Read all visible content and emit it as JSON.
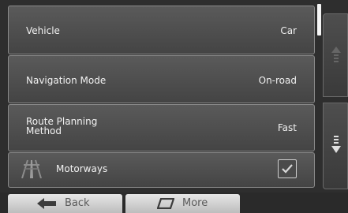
{
  "settings": {
    "vehicle": {
      "label": "Vehicle",
      "value": "Car"
    },
    "navigation_mode": {
      "label": "Navigation Mode",
      "value": "On-road"
    },
    "route_planning": {
      "label_line1": "Route Planning",
      "label_line2": "Method",
      "value": "Fast"
    },
    "motorways": {
      "label": "Motorways",
      "checked": true,
      "icon": "motorway-icon"
    }
  },
  "scroll": {
    "up_icon": "scroll-up-arrow-icon",
    "down_icon": "scroll-down-arrow-icon"
  },
  "bottom_bar": {
    "back_label": "Back",
    "more_label": "More",
    "back_icon": "back-arrow-icon",
    "more_icon": "more-icon"
  },
  "colors": {
    "background": "#2e2e2e",
    "row": "#4f4f4f",
    "button": "#d5d5d5"
  }
}
